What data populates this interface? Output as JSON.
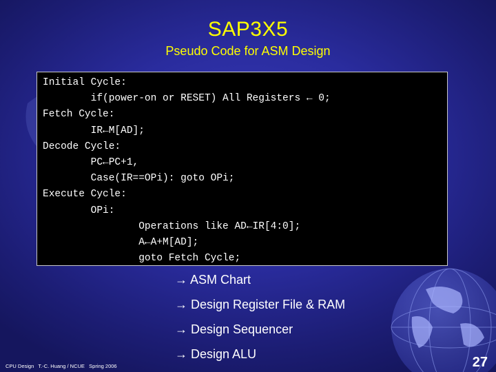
{
  "slide": {
    "title": "SAP3X5",
    "subtitle": "Pseudo Code for ASM Design",
    "code_lines": [
      "Initial Cycle:",
      "        if(power-on or RESET) All Registers ← 0;",
      "Fetch Cycle:",
      "        IR←M[AD];",
      "Decode Cycle:",
      "        PC←PC+1,",
      "        Case(IR==OPi): goto OPi;",
      "Execute Cycle:",
      "        OPi:",
      "                Operations like AD←IR[4:0];",
      "                A←A+M[AD];",
      "                goto Fetch Cycle;"
    ],
    "bullets": [
      "→ ASM Chart",
      "→ Design Register File & RAM",
      "→ Design Sequencer",
      "→ Design ALU"
    ],
    "footer": "CPU Design   T.-C. Huang / NCUE   Spring 2006",
    "page_number": "27"
  },
  "colors": {
    "title": "#ffff00",
    "background": "#2a2c9e",
    "code_bg": "#000000"
  },
  "icons": [
    "world-map-background",
    "globe-icon"
  ]
}
